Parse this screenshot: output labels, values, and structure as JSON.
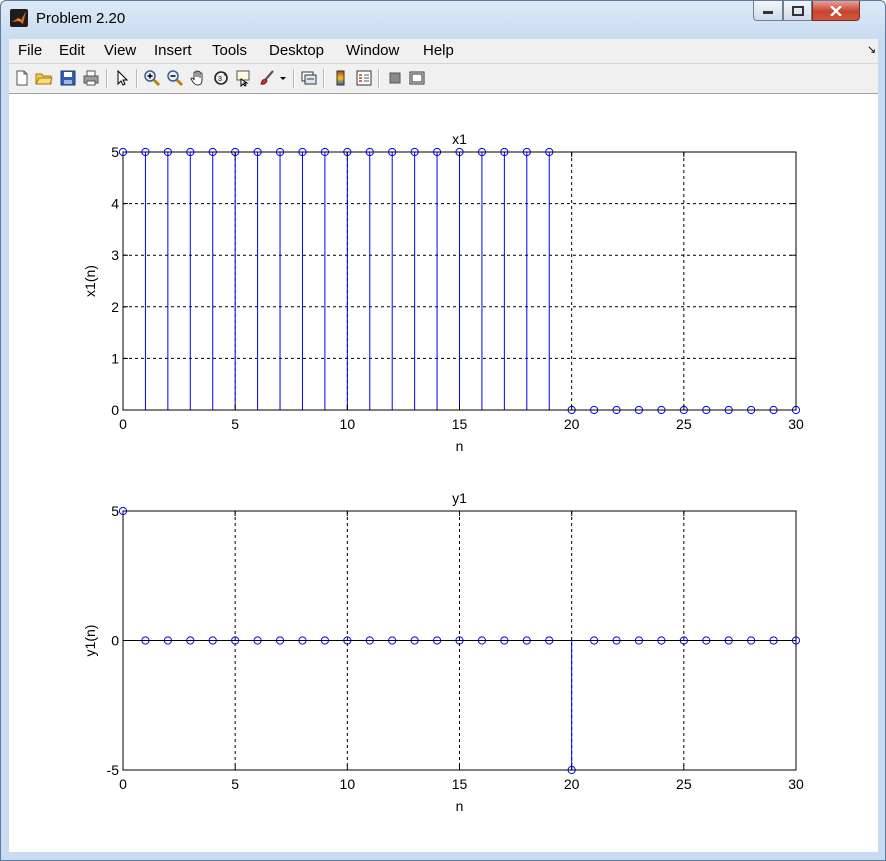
{
  "window": {
    "title": "Problem 2.20",
    "buttons": [
      "minimize",
      "maximize",
      "close"
    ],
    "icon": "matlab-logo-icon"
  },
  "menu": {
    "items": [
      "File",
      "Edit",
      "View",
      "Insert",
      "Tools",
      "Desktop",
      "Window",
      "Help"
    ],
    "dock_glyph": "↘"
  },
  "toolbar": {
    "icons": [
      "new-figure-icon",
      "open-file-icon",
      "save-icon",
      "print-icon",
      "select-arrow-icon",
      "zoom-in-icon",
      "zoom-out-icon",
      "pan-hand-icon",
      "rotate-3d-icon",
      "data-cursor-icon",
      "brush-icon",
      "brush-dropdown-icon",
      "link-plot-icon",
      "insert-colorbar-icon",
      "insert-legend-icon",
      "hide-plot-tools-icon",
      "show-plot-tools-icon"
    ]
  },
  "colors": {
    "stem": "#0000ff",
    "axes": "#000000",
    "grid": "#000000",
    "figure_bg": "#ffffff"
  },
  "chart_data": [
    {
      "type": "stem",
      "title": "x1",
      "xlabel": "n",
      "ylabel": "x1(n)",
      "xlim": [
        0,
        30
      ],
      "ylim": [
        0,
        5
      ],
      "xticks": [
        0,
        5,
        10,
        15,
        20,
        25,
        30
      ],
      "yticks": [
        0,
        1,
        2,
        3,
        4,
        5
      ],
      "grid": true,
      "x": [
        0,
        1,
        2,
        3,
        4,
        5,
        6,
        7,
        8,
        9,
        10,
        11,
        12,
        13,
        14,
        15,
        16,
        17,
        18,
        19,
        20,
        21,
        22,
        23,
        24,
        25,
        26,
        27,
        28,
        29,
        30
      ],
      "y": [
        5,
        5,
        5,
        5,
        5,
        5,
        5,
        5,
        5,
        5,
        5,
        5,
        5,
        5,
        5,
        5,
        5,
        5,
        5,
        5,
        0,
        0,
        0,
        0,
        0,
        0,
        0,
        0,
        0,
        0,
        0
      ]
    },
    {
      "type": "stem",
      "title": "y1",
      "xlabel": "n",
      "ylabel": "y1(n)",
      "xlim": [
        0,
        30
      ],
      "ylim": [
        -5,
        5
      ],
      "xticks": [
        0,
        5,
        10,
        15,
        20,
        25,
        30
      ],
      "yticks": [
        -5,
        0,
        5
      ],
      "grid": true,
      "x": [
        0,
        1,
        2,
        3,
        4,
        5,
        6,
        7,
        8,
        9,
        10,
        11,
        12,
        13,
        14,
        15,
        16,
        17,
        18,
        19,
        20,
        21,
        22,
        23,
        24,
        25,
        26,
        27,
        28,
        29,
        30
      ],
      "y": [
        5,
        0,
        0,
        0,
        0,
        0,
        0,
        0,
        0,
        0,
        0,
        0,
        0,
        0,
        0,
        0,
        0,
        0,
        0,
        0,
        -5,
        0,
        0,
        0,
        0,
        0,
        0,
        0,
        0,
        0,
        0
      ]
    }
  ]
}
